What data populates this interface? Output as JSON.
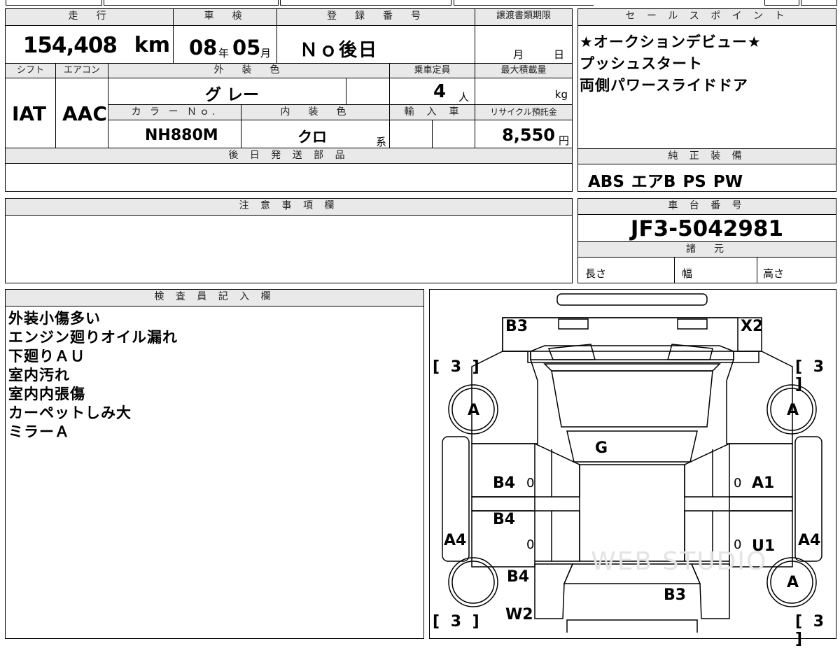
{
  "header": {
    "mileage_label": "走　行",
    "inspection_label": "車　検",
    "registration_label": "登　録　番　号",
    "transfer_deadline_label": "譲渡書類期限",
    "sales_points_label": "セ ー ル ス ポ イ ン ト"
  },
  "values": {
    "mileage": "154,408",
    "mileage_unit": "km",
    "inspection_year": "08",
    "year_unit": "年",
    "inspection_month": "05",
    "month_unit": "月",
    "registration_number": "Ｎｏ後日",
    "deadline_month_unit": "月",
    "deadline_day_unit": "日"
  },
  "row2": {
    "shift_label": "シフト",
    "aircon_label": "エアコン",
    "exterior_color_label": "外　装　色",
    "capacity_label": "乗車定員",
    "max_load_label": "最大積載量",
    "shift": "IAT",
    "aircon": "AAC",
    "exterior_color": "グ レー",
    "capacity": "4",
    "capacity_unit": "人",
    "load_unit": "kg"
  },
  "row3": {
    "color_no_label": "カ ラ ー Ｎｏ.",
    "interior_color_label": "内　装　色",
    "import_label": "輸　入　車",
    "recycle_label": "リサイクル預託金",
    "color_no": "NH880M",
    "interior_color": "クロ",
    "interior_suffix": "系",
    "recycle_fee": "8,550",
    "recycle_unit": "円"
  },
  "later_parts": {
    "label": "後 日 発 送 部 品",
    "value": ""
  },
  "sales_points": [
    "★オークションデビュー★",
    "プッシュスタート",
    "両側パワースライドドア"
  ],
  "equipment": {
    "label": "純 正 装 備",
    "value": "ABS エアB PS PW"
  },
  "notes": {
    "label": "注 意 事 項 欄",
    "value": ""
  },
  "chassis": {
    "label": "車 台 番 号",
    "value": "JF3-5042981"
  },
  "specs": {
    "label": "諸　元",
    "length_label": "長さ",
    "width_label": "幅",
    "height_label": "高さ"
  },
  "inspector": {
    "label": "検 査 員 記 入 欄",
    "lines": [
      "外装小傷多い",
      "エンジン廻りオイル漏れ",
      "下廻りＡＵ",
      "室内汚れ",
      "室内内張傷",
      "カーペットしみ大",
      "ミラーＡ"
    ]
  },
  "diagram": {
    "marks": {
      "b3_top": "B3",
      "x2_top": "X2",
      "tire_fl": "[ 3 ]",
      "tire_fr": "[ 3 ]",
      "tire_rl": "[ 3 ]",
      "tire_rr": "[ 3 ]",
      "wheel_fl": "A",
      "wheel_fr": "A",
      "wheel_rr": "A",
      "g": "G",
      "b4_1": "B4",
      "b4_2": "B4",
      "b4_3": "B4",
      "a1": "A1",
      "u1": "U1",
      "a4_l": "A4",
      "a4_r": "A4",
      "b3_bottom": "B3",
      "w2": "W2",
      "zero1": "0",
      "zero2": "0",
      "zero3": "0",
      "zero4": "0"
    },
    "watermark": "WEB STUDIO"
  }
}
